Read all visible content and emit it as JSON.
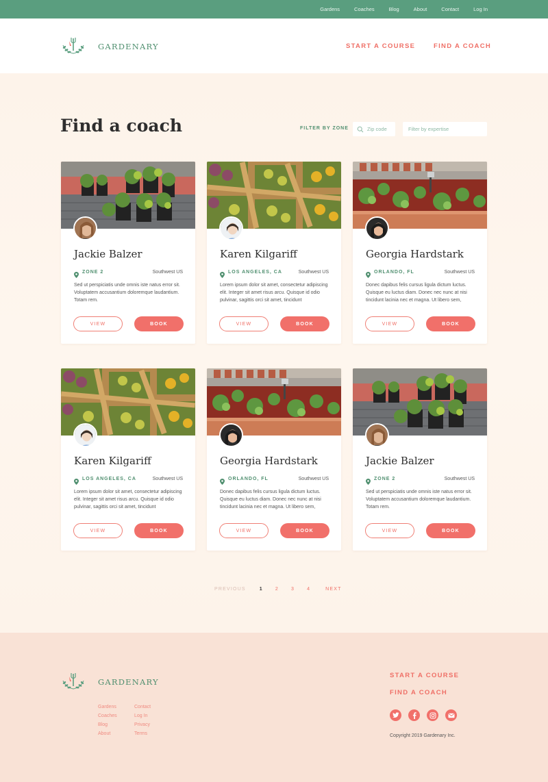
{
  "topnav": {
    "items": [
      "Gardens",
      "Coaches",
      "Blog",
      "About",
      "Contact",
      "Log In"
    ]
  },
  "header": {
    "brand": "GARDENARY",
    "cta_course": "START A COURSE",
    "cta_coach": "FIND A COACH"
  },
  "page": {
    "title": "Find a coach",
    "filter_label": "FILTER BY ZONE",
    "zip_placeholder": "Zip code",
    "expertise_placeholder": "Filter by expertise"
  },
  "coaches": [
    {
      "name": "Jackie Balzer",
      "location": "ZONE 2",
      "region": "Southwest US",
      "description": "Sed ut perspiciatis unde omnis iste natus error sit. Voluptatem accusantium doloremque laudantium. Totam rem.",
      "view": "VIEW",
      "book": "BOOK",
      "photo": "planters",
      "avatar": "tan"
    },
    {
      "name": "Karen Kilgariff",
      "location": "LOS ANGELES, CA",
      "region": "Southwest US",
      "description": "Lorem ipsum dolor sit amet, consectetur adipiscing elit. Integer sit amet risus arcu. Quisque id odio pulvinar, sagittis orci sit amet, tincidunt",
      "view": "VIEW",
      "book": "BOOK",
      "photo": "crates",
      "avatar": "light"
    },
    {
      "name": "Georgia Hardstark",
      "location": "ORLANDO, FL",
      "region": "Southwest US",
      "description": "Donec dapibus felis cursus ligula dictum luctus. Quisque eu luctus diam. Donec nec nunc at nisi tincidunt lacinia nec et magna. Ut libero sem,",
      "view": "VIEW",
      "book": "BOOK",
      "photo": "boxes",
      "avatar": "dark"
    },
    {
      "name": "Karen Kilgariff",
      "location": "LOS ANGELES, CA",
      "region": "Southwest US",
      "description": "Lorem ipsum dolor sit amet, consectetur adipiscing elit. Integer sit amet risus arcu. Quisque id odio pulvinar, sagittis orci sit amet, tincidunt",
      "view": "VIEW",
      "book": "BOOK",
      "photo": "crates",
      "avatar": "light"
    },
    {
      "name": "Georgia Hardstark",
      "location": "ORLANDO, FL",
      "region": "Southwest US",
      "description": "Donec dapibus felis cursus ligula dictum luctus. Quisque eu luctus diam. Donec nec nunc at nisi tincidunt lacinia nec et magna. Ut libero sem,",
      "view": "VIEW",
      "book": "BOOK",
      "photo": "boxes",
      "avatar": "dark"
    },
    {
      "name": "Jackie Balzer",
      "location": "ZONE 2",
      "region": "Southwest US",
      "description": "Sed ut perspiciatis unde omnis iste natus error sit. Voluptatem accusantium doloremque laudantium. Totam rem.",
      "view": "VIEW",
      "book": "BOOK",
      "photo": "planters",
      "avatar": "tan"
    }
  ],
  "pagination": {
    "previous": "PREVIOUS",
    "pages": [
      "1",
      "2",
      "3",
      "4"
    ],
    "current": "1",
    "next": "NEXT"
  },
  "footer": {
    "brand": "GARDENARY",
    "links": [
      "Gardens",
      "Contact",
      "Coaches",
      "Log In",
      "Blog",
      "Privacy",
      "About",
      "Terms"
    ],
    "cta_course": "START A COURSE",
    "cta_coach": "FIND A COACH",
    "socials": [
      "twitter-icon",
      "facebook-icon",
      "instagram-icon",
      "email-icon"
    ],
    "copyright": "Copyright 2019 Gardenary Inc."
  },
  "colors": {
    "green": "#5a9e7f",
    "coral": "#f1706a",
    "background": "#fdf3ea",
    "footer": "#f9e2d6"
  }
}
